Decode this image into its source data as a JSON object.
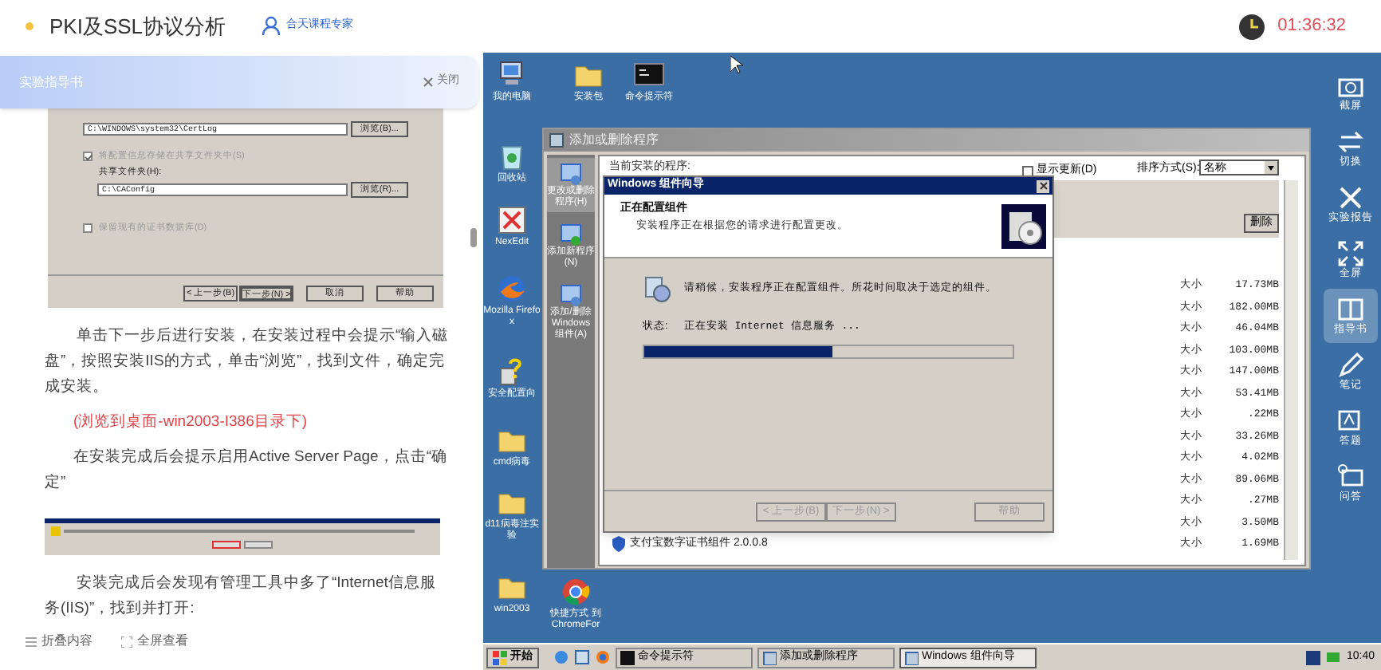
{
  "header": {
    "title": "PKI及SSL协议分析",
    "author": "合天课程专家",
    "timer": "01:36:32"
  },
  "guide": {
    "banner_title": "实验指导书",
    "close_label": "关闭",
    "figure": {
      "log_path": "C:\\WINDOWS\\system32\\CertLog",
      "browse_1": "浏览(B)...",
      "share_option": {
        "label": "将配置信息存储在共享文件夹中(S)",
        "checked": true
      },
      "share_label": "共享文件夹(H):",
      "share_path": "C:\\CAConfig",
      "browse_2": "浏览(R)...",
      "keep_option": {
        "label": "保留现有的证书数据库(D)",
        "checked": false
      },
      "buttons": [
        "< 上一步(B)",
        "下一步(N) >",
        "取消",
        "帮助"
      ]
    },
    "paragraph_1": "单击下一步后进行安装，在安装过程中会提示“输入磁盘”，按照安装IIS的方式，单击“浏览”，找到文件，确定完成安装。",
    "note": "(浏览到桌面-win2003-I386目录下)",
    "paragraph_2": "在安装完成后会提示启用Active Server Page，点击“确定”",
    "paragraph_3": "安装完成后会发现有管理工具中多了“Internet信息服务(IIS)”，找到并打开:",
    "actions": [
      "折叠内容",
      "全屏查看"
    ]
  },
  "desktop": {
    "icons": [
      {
        "label": "我的电脑",
        "kind": "computer"
      },
      {
        "label": "安装包",
        "kind": "folder"
      },
      {
        "label": "命令提示符",
        "kind": "console"
      },
      {
        "label": "回收站",
        "kind": "recycle"
      },
      {
        "label": "NexEdit",
        "kind": "editor"
      },
      {
        "label": "Mozilla Firefox",
        "kind": "browser"
      },
      {
        "label": "安全配置向",
        "kind": "help"
      },
      {
        "label": "cmd病毒",
        "kind": "folder"
      },
      {
        "label": "d11病毒注实验",
        "kind": "folder"
      },
      {
        "label": "win2003",
        "kind": "folder"
      },
      {
        "label": "快捷方式 到 ChromeFor",
        "kind": "chrome"
      }
    ]
  },
  "programs_window": {
    "title": "添加或删除程序",
    "sidebar": [
      {
        "label": "更改或删除程序(H)",
        "selected": true
      },
      {
        "label": "添加新程序(N)",
        "selected": false
      },
      {
        "label": "添加/删除Windows组件(A)",
        "selected": false
      }
    ],
    "current_label": "当前安装的程序:",
    "show_updates": {
      "label": "显示更新(D)",
      "checked": false
    },
    "sort_label": "排序方式(S):",
    "sort_value": "名称",
    "remove_button": "删除",
    "sizes": [
      {
        "label": "大小",
        "value": "17.73MB"
      },
      {
        "label": "大小",
        "value": "182.00MB"
      },
      {
        "label": "大小",
        "value": "46.04MB"
      },
      {
        "label": "大小",
        "value": "103.00MB"
      },
      {
        "label": "大小",
        "value": "147.00MB"
      },
      {
        "label": "大小",
        "value": "53.41MB"
      },
      {
        "label": "大小",
        "value": ".22MB"
      },
      {
        "label": "大小",
        "value": "33.26MB"
      },
      {
        "label": "大小",
        "value": "4.02MB"
      },
      {
        "label": "大小",
        "value": "89.06MB"
      },
      {
        "label": "大小",
        "value": ".27MB"
      },
      {
        "label": "大小",
        "value": "3.50MB"
      },
      {
        "label": "大小",
        "value": "1.69MB"
      }
    ],
    "last_program": "支付宝数字证书组件 2.0.0.8"
  },
  "wizard": {
    "title": "Windows 组件向导",
    "heading": "正在配置组件",
    "subheading": "安装程序正在根据您的请求进行配置更改。",
    "message": "请稍候，安装程序正在配置组件。所花时间取决于选定的组件。",
    "status_label": "状态:",
    "status_text": "正在安装 Internet 信息服务 ...",
    "progress": {
      "level": 0.51
    },
    "buttons": [
      {
        "label": "< 上一步(B)",
        "disabled": true
      },
      {
        "label": "下一步(N) >",
        "disabled": true
      },
      {
        "label": "帮助",
        "disabled": true
      }
    ]
  },
  "tools": [
    {
      "label": "截屏",
      "kind": "camera",
      "selected": false
    },
    {
      "label": "切换",
      "kind": "switch",
      "selected": false
    },
    {
      "label": "实验报告",
      "kind": "tools",
      "selected": false
    },
    {
      "label": "全屏",
      "kind": "expand",
      "selected": false
    },
    {
      "label": "指导书",
      "kind": "book",
      "selected": true
    },
    {
      "label": "笔记",
      "kind": "pen",
      "selected": false
    },
    {
      "label": "答题",
      "kind": "answer",
      "selected": false
    },
    {
      "label": "问答",
      "kind": "chat",
      "selected": false
    }
  ],
  "taskbar": {
    "start": "开始",
    "tasks": [
      {
        "label": "命令提示符",
        "selected": false
      },
      {
        "label": "添加或删除程序",
        "selected": false
      },
      {
        "label": "Windows 组件向导",
        "selected": true
      }
    ],
    "clock": "10:40"
  }
}
